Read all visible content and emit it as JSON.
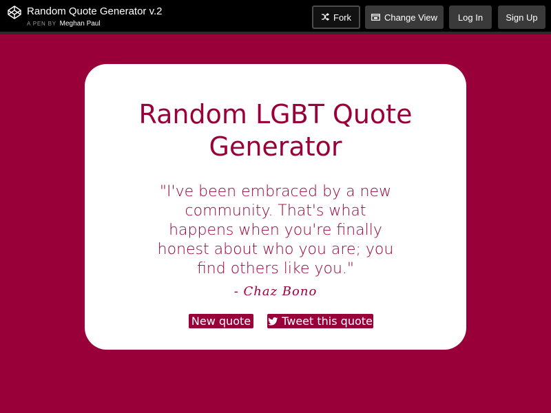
{
  "header": {
    "pen_title": "Random Quote Generator v.2",
    "byline_prefix": "A PEN BY",
    "author_name": "Meghan Paul",
    "buttons": {
      "fork": "Fork",
      "change_view": "Change View",
      "log_in": "Log In",
      "sign_up": "Sign Up"
    },
    "icons": {
      "logo": "codepen-logo-icon",
      "fork": "fork-icon",
      "change_view": "change-view-icon"
    }
  },
  "card": {
    "title": "Random LGBT Quote Generator",
    "quote": "\"I've been embraced by a new community. That's what happens when you're finally honest about who you are; you find others like you.\"",
    "author": "- Chaz Bono",
    "new_quote_label": "New quote",
    "tweet_label": "Tweet this quote",
    "tweet_icon": "twitter-bird-icon"
  },
  "colors": {
    "page_background": "#990039",
    "accent": "#990039",
    "topbar": "#000000",
    "card": "#ffffff"
  }
}
